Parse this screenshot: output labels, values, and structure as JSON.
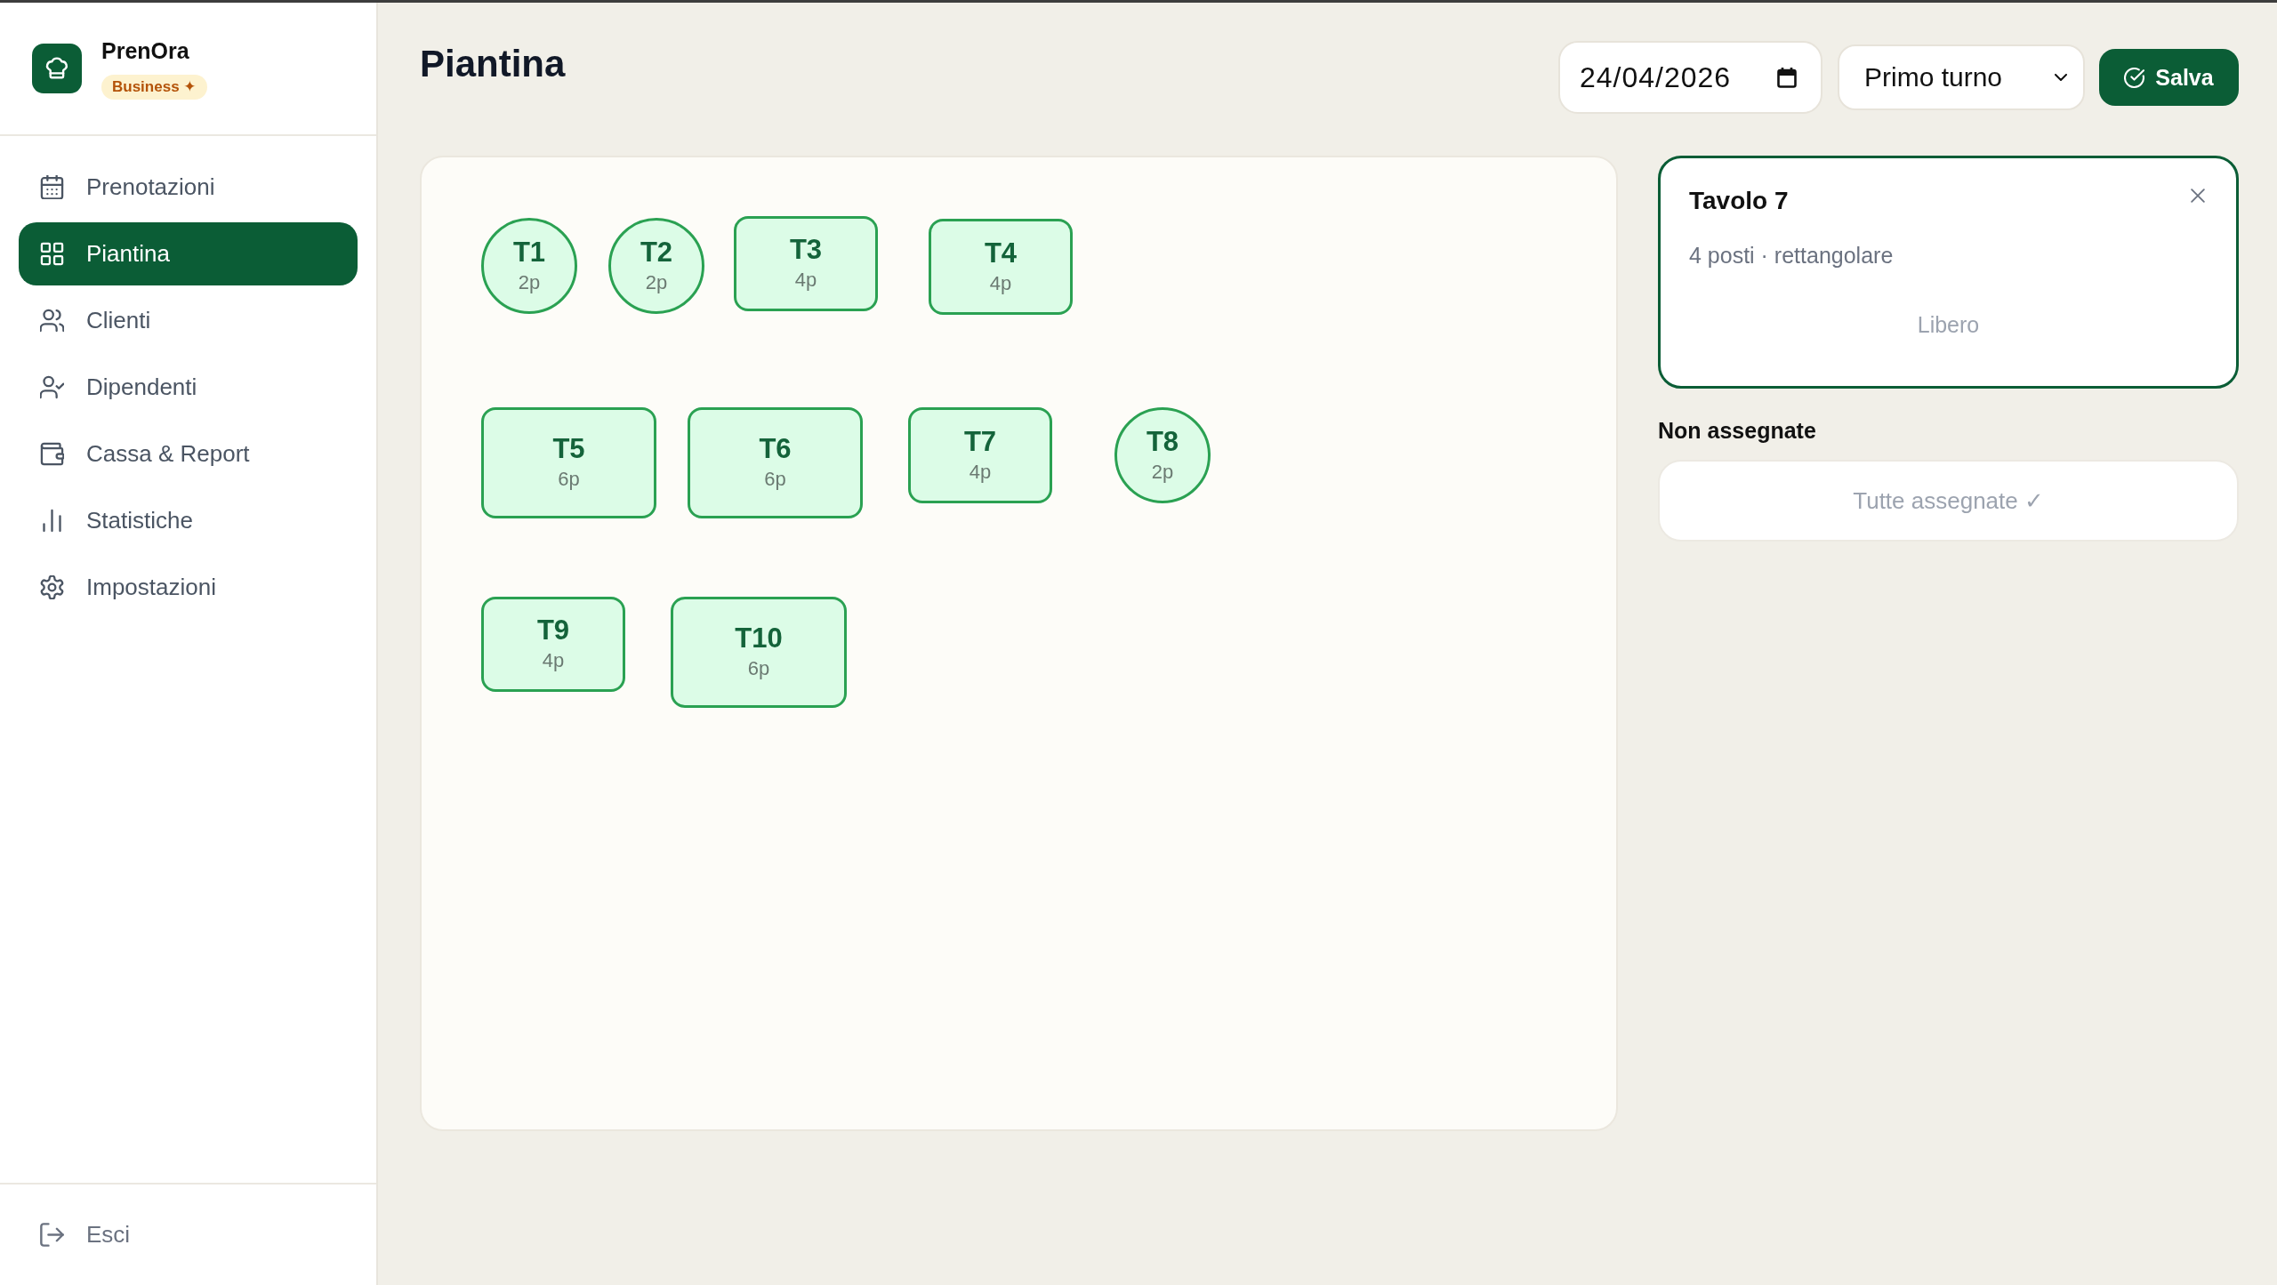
{
  "sidebar": {
    "brand": {
      "name": "PrenOra",
      "plan": "Business ✦"
    },
    "nav": [
      {
        "label": "Prenotazioni",
        "selected": false
      },
      {
        "label": "Piantina",
        "selected": true
      },
      {
        "label": "Clienti",
        "selected": false
      },
      {
        "label": "Dipendenti",
        "selected": false
      },
      {
        "label": "Cassa & Report",
        "selected": false
      },
      {
        "label": "Statistiche",
        "selected": false
      },
      {
        "label": "Impostazioni",
        "selected": false
      }
    ],
    "logout": {
      "label": "Esci"
    }
  },
  "header": {
    "title": "Piantina",
    "date": {
      "value": "24/04/2026"
    },
    "shift": {
      "value": "Primo turno"
    },
    "save_button": "Salva"
  },
  "floor_plan": {
    "tables": [
      {
        "name": "T1",
        "seats": "2p",
        "kind": "round"
      },
      {
        "name": "T2",
        "seats": "2p",
        "kind": "round"
      },
      {
        "name": "T3",
        "seats": "4p",
        "kind": "rect"
      },
      {
        "name": "T4",
        "seats": "4p",
        "kind": "rect"
      },
      {
        "name": "T5",
        "seats": "6p",
        "kind": "rect"
      },
      {
        "name": "T6",
        "seats": "6p",
        "kind": "rect"
      },
      {
        "name": "T7",
        "seats": "4p",
        "kind": "rect"
      },
      {
        "name": "T8",
        "seats": "2p",
        "kind": "round"
      },
      {
        "name": "T9",
        "seats": "4p",
        "kind": "rect"
      },
      {
        "name": "T10",
        "seats": "6p",
        "kind": "rect"
      }
    ]
  },
  "details": {
    "title": "Tavolo 7",
    "info": "4 posti · rettangolare",
    "status": "Libero"
  },
  "unassigned": {
    "title": "Non assegnate",
    "empty_text": "Tutte assegnate ✓"
  }
}
